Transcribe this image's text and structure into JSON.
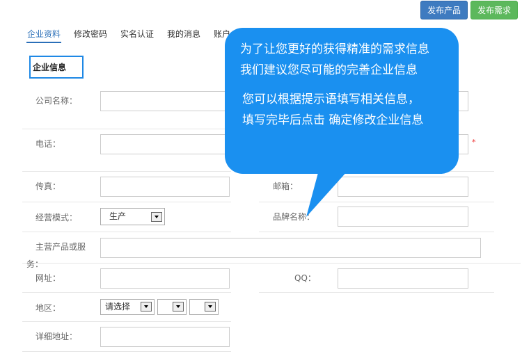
{
  "header": {
    "publish_product": "发布产品",
    "publish_demand": "发布需求"
  },
  "tabs": [
    {
      "label": "企业资料"
    },
    {
      "label": "修改密码"
    },
    {
      "label": "实名认证"
    },
    {
      "label": "我的消息"
    },
    {
      "label": "账户"
    }
  ],
  "section_title": "企业信息",
  "form": {
    "company_name": "公司名称：",
    "phone": "电话：",
    "fax": "传真：",
    "email": "邮箱：",
    "business_mode": "经营模式：",
    "business_mode_value": "生产",
    "brand_name": "品牌名称：",
    "main_products_1": "主营产品或服",
    "main_products_2": "务：",
    "website": "网址：",
    "qq": "QQ：",
    "region": "地区：",
    "region_value": "请选择",
    "address": "详细地址：",
    "required_mark": "*"
  },
  "tooltip": {
    "line1": "为了让您更好的获得精准的需求信息",
    "line2": "我们建议您尽可能的完善企业信息",
    "line3": "您可以根据提示语填写相关信息，",
    "line4": "填写完毕后点击 确定修改企业信息"
  },
  "colors": {
    "accent": "#2a6fb8",
    "tooltip_bg": "#1a90f0",
    "primary_button": "#3e7bc0",
    "success_button": "#5cb85c"
  }
}
